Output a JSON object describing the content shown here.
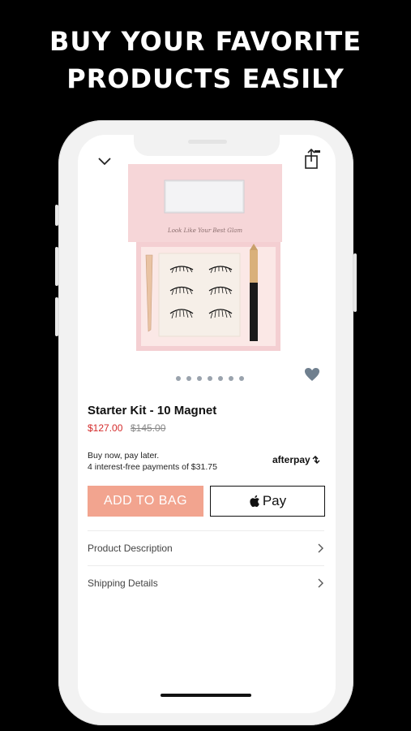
{
  "headline": {
    "line1": "BUY YOUR FAVORITE",
    "line2": "PRODUCTS EASILY"
  },
  "product": {
    "box_script_text": "Look Like Your Best Glam",
    "title": "Starter Kit - 10 Magnet",
    "price": "$127.00",
    "original_price": "$145.00",
    "image_count": 7
  },
  "afterpay": {
    "line1": "Buy now, pay later.",
    "line2": "4 interest-free payments of $31.75",
    "logo_text": "afterpay"
  },
  "buttons": {
    "add_to_bag": "ADD TO BAG",
    "apple_pay": "Pay"
  },
  "details": [
    {
      "label": "Product Description"
    },
    {
      "label": "Shipping Details"
    }
  ],
  "icons": [
    "chevron-down-icon",
    "share-icon",
    "heart-icon",
    "apple-icon",
    "chevron-right-icon"
  ],
  "colors": {
    "accent": "#f2a48f",
    "sale": "#d42b2b",
    "box_pink": "#f6d6d8"
  }
}
